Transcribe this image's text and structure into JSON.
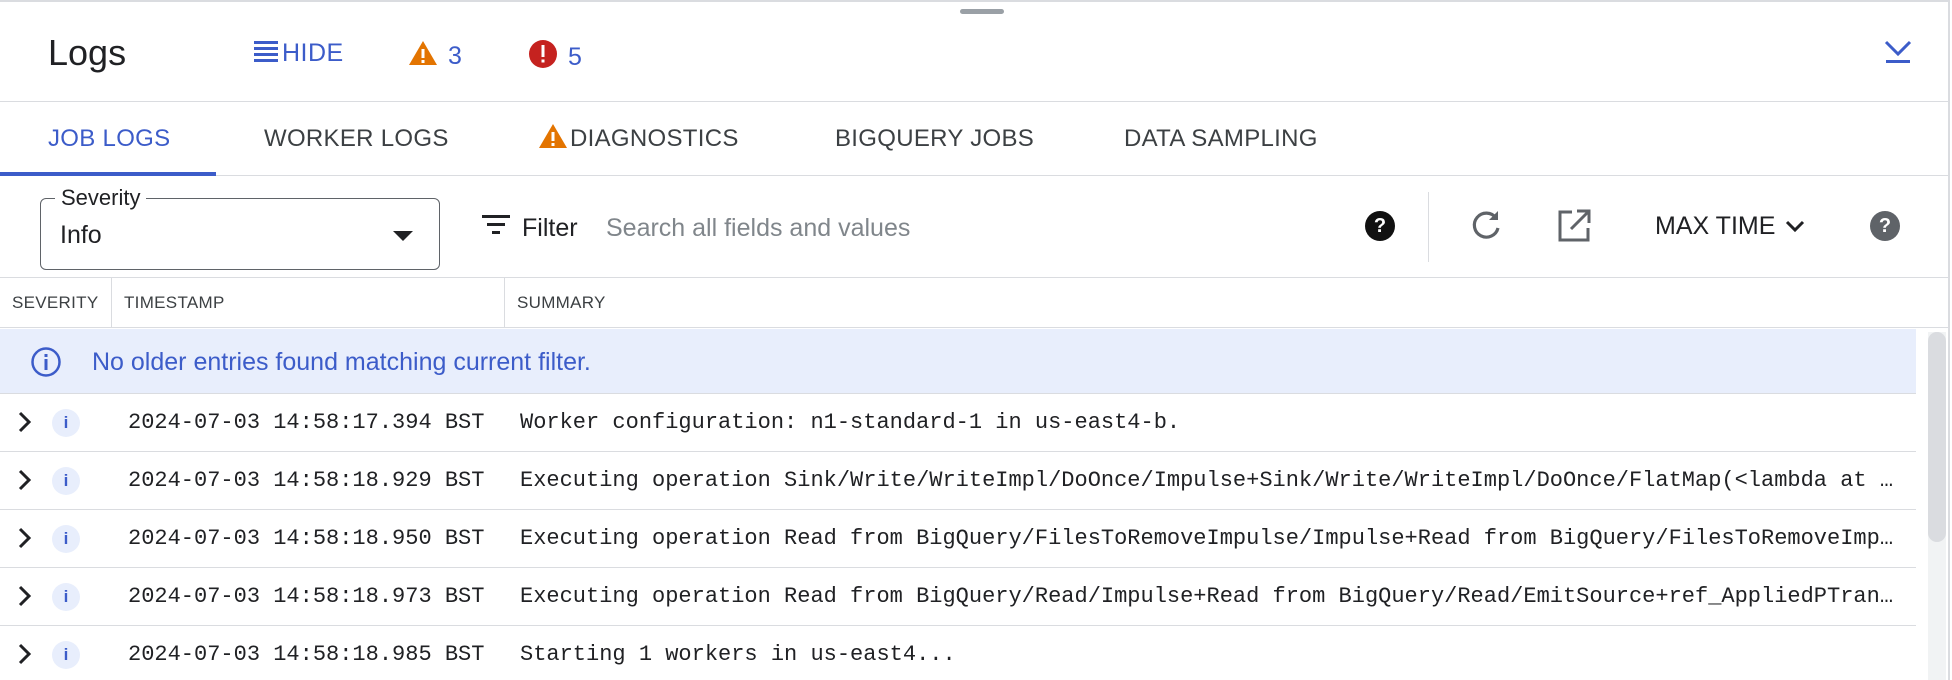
{
  "header": {
    "title": "Logs",
    "hide_label": "HIDE",
    "warning_count": "3",
    "error_count": "5"
  },
  "tabs": [
    {
      "label": "JOB LOGS",
      "active": true
    },
    {
      "label": "WORKER LOGS",
      "active": false
    },
    {
      "label": "DIAGNOSTICS",
      "active": false,
      "icon": "warning-icon"
    },
    {
      "label": "BIGQUERY JOBS",
      "active": false
    },
    {
      "label": "DATA SAMPLING",
      "active": false
    }
  ],
  "toolbar": {
    "severity_label": "Severity",
    "severity_value": "Info",
    "filter_label": "Filter",
    "search_placeholder": "Search all fields and values",
    "max_time_label": "MAX TIME"
  },
  "table": {
    "columns": [
      "SEVERITY",
      "TIMESTAMP",
      "SUMMARY"
    ],
    "banner": "No older entries found matching current filter.",
    "rows": [
      {
        "severity": "i",
        "timestamp": "2024-07-03 14:58:17.394 BST",
        "summary": "Worker configuration: n1-standard-1 in us-east4-b."
      },
      {
        "severity": "i",
        "timestamp": "2024-07-03 14:58:18.929 BST",
        "summary": "Executing operation Sink/Write/WriteImpl/DoOnce/Impulse+Sink/Write/WriteImpl/DoOnce/FlatMap(<lambda at …"
      },
      {
        "severity": "i",
        "timestamp": "2024-07-03 14:58:18.950 BST",
        "summary": "Executing operation Read from BigQuery/FilesToRemoveImpulse/Impulse+Read from BigQuery/FilesToRemoveImp…"
      },
      {
        "severity": "i",
        "timestamp": "2024-07-03 14:58:18.973 BST",
        "summary": "Executing operation Read from BigQuery/Read/Impulse+Read from BigQuery/Read/EmitSource+ref_AppliedPTran…"
      },
      {
        "severity": "i",
        "timestamp": "2024-07-03 14:58:18.985 BST",
        "summary": "Starting 1 workers in us-east4..."
      }
    ]
  },
  "colors": {
    "accent": "#3c5cc9",
    "warning": "#e37400",
    "error": "#c5221f",
    "banner_bg": "#e8eefc"
  }
}
